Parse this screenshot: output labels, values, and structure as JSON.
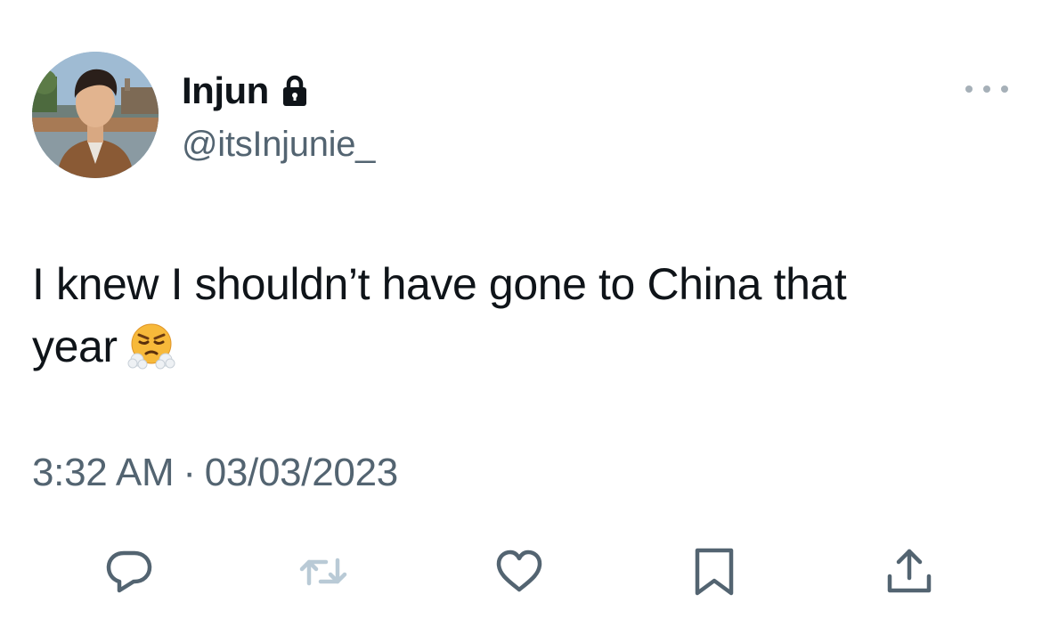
{
  "user": {
    "display_name": "Injun",
    "handle": "@itsInjunie_",
    "protected_icon": "lock-icon",
    "avatar": "profile-photo"
  },
  "tweet": {
    "text_line1": "I knew I shouldn’t have gone to China that",
    "text_line2": "year",
    "emoji": "face-with-steam-from-nose",
    "time": "3:32 AM",
    "separator": "·",
    "date": "03/03/2023"
  },
  "actions": [
    {
      "icon": "reply-icon"
    },
    {
      "icon": "retweet-icon",
      "disabled": true
    },
    {
      "icon": "like-icon"
    },
    {
      "icon": "bookmark-icon"
    },
    {
      "icon": "share-icon"
    }
  ],
  "colors": {
    "text": "#0f1419",
    "secondary": "#536471",
    "icon": "#536471",
    "icon_disabled": "#b9cad6",
    "background": "#ffffff"
  }
}
